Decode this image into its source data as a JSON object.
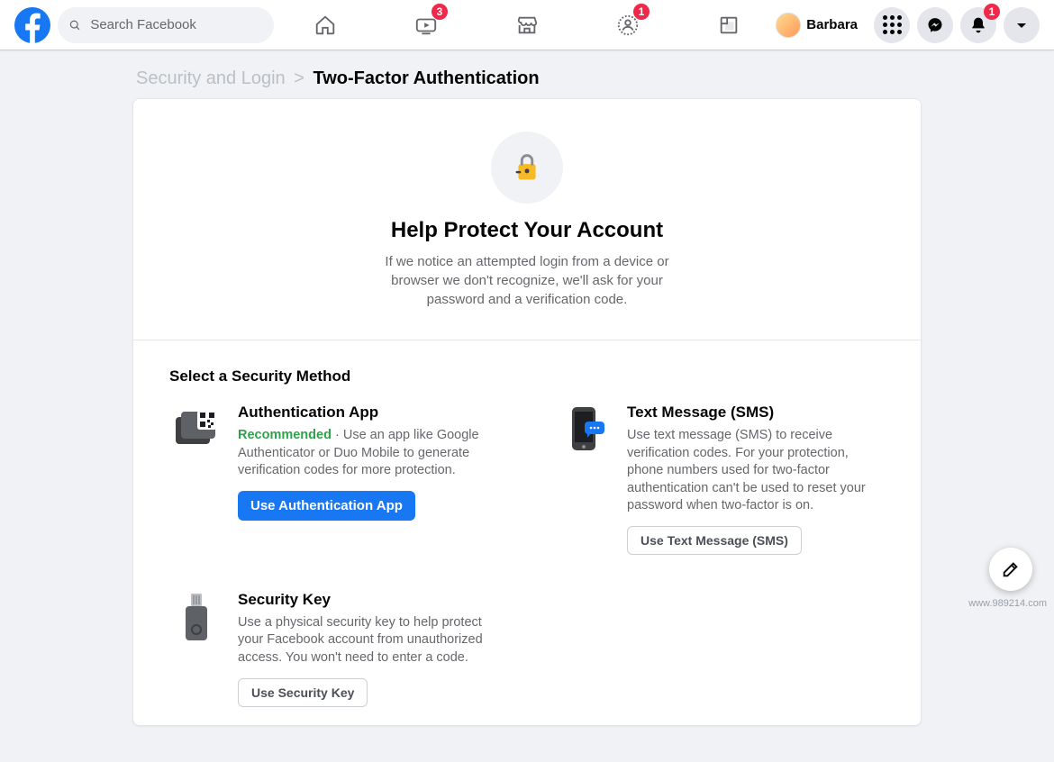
{
  "header": {
    "search_placeholder": "Search Facebook",
    "nav_badges": {
      "watch": "3",
      "friends": "1"
    },
    "profile_name": "Barbara",
    "notif_badge": "1"
  },
  "breadcrumb": {
    "parent": "Security and Login",
    "separator": ">",
    "current": "Two-Factor Authentication"
  },
  "hero": {
    "title": "Help Protect Your Account",
    "subtitle": "If we notice an attempted login from a device or browser we don't recognize, we'll ask for your password and a verification code."
  },
  "methods": {
    "heading": "Select a Security Method",
    "auth_app": {
      "title": "Authentication App",
      "recommended_label": "Recommended",
      "recommended_sep": " · ",
      "desc": "Use an app like Google Authenticator or Duo Mobile to generate verification codes for more protection.",
      "button": "Use Authentication App"
    },
    "sms": {
      "title": "Text Message (SMS)",
      "desc": "Use text message (SMS) to receive verification codes. For your protection, phone numbers used for two-factor authentication can't be used to reset your password when two-factor is on.",
      "button": "Use Text Message (SMS)"
    },
    "key": {
      "title": "Security Key",
      "desc": "Use a physical security key to help protect your Facebook account from unauthorized access. You won't need to enter a code.",
      "button": "Use Security Key"
    }
  },
  "watermark": "www.989214.com"
}
